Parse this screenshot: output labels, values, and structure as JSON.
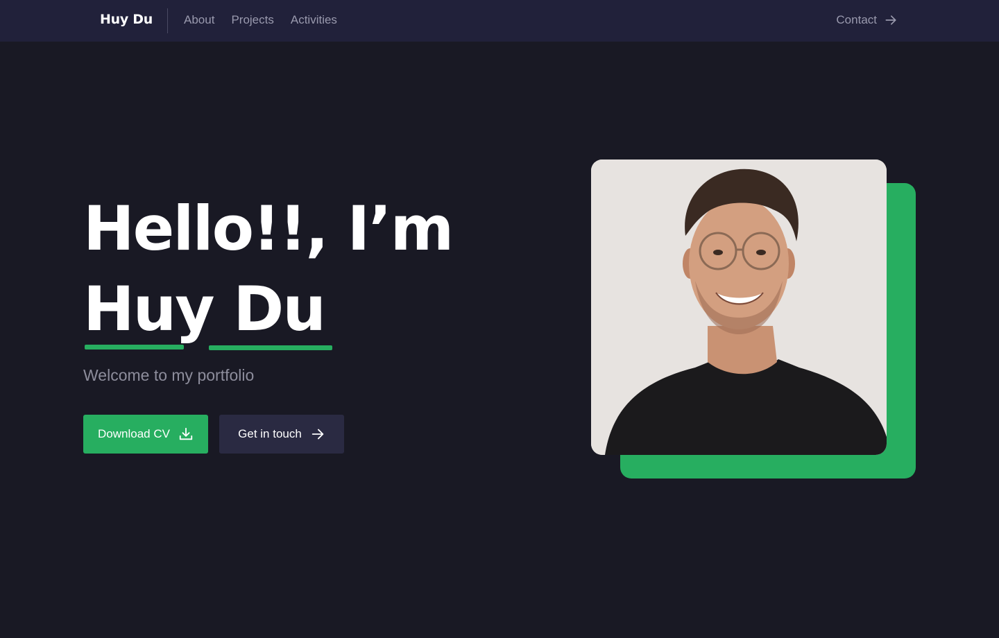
{
  "nav": {
    "brand": "Huy Du",
    "links": [
      {
        "label": "About"
      },
      {
        "label": "Projects"
      },
      {
        "label": "Activities"
      }
    ],
    "contact_label": "Contact",
    "contact_icon": "arrow-right-icon"
  },
  "hero": {
    "title_line1": "Hello!!, I’m",
    "title_line2": "Huy Du",
    "subtitle": "Welcome to my portfolio",
    "primary_button": {
      "label": "Download CV",
      "icon": "download-icon"
    },
    "secondary_button": {
      "label": "Get in touch",
      "icon": "arrow-right-icon"
    }
  },
  "colors": {
    "background": "#191924",
    "navbar": "#21213a",
    "accent": "#27ae60",
    "secondary_button": "#2a2a42",
    "muted_text": "#9a9aae"
  }
}
